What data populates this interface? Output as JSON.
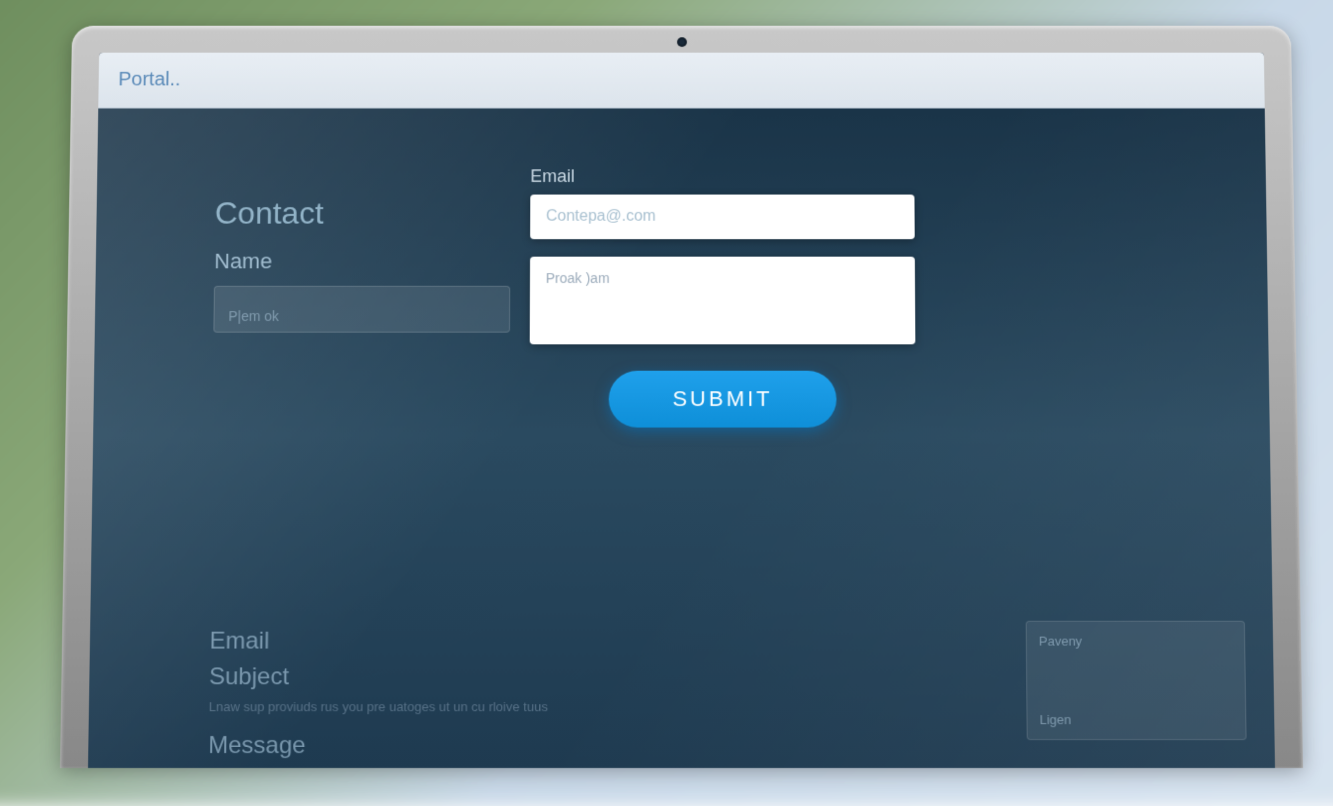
{
  "browser": {
    "address": "Portal.."
  },
  "page": {
    "title": "Contact"
  },
  "left_panel": {
    "name_label": "Name",
    "name_placeholder": "P|em  ok"
  },
  "center_form": {
    "email_label": "Email",
    "email_placeholder": "Contepa@.com",
    "message_placeholder": "Proak )am",
    "submit_label": "SUBMIT"
  },
  "bottom_labels": {
    "email": "Email",
    "subject": "Subject",
    "subject_desc": "Lnaw sup proviuds rus you pre uatoges  ut un  cu rloive tuus",
    "message": "Message"
  },
  "side_box": {
    "top": "Paveny",
    "bottom": "Ligen"
  },
  "colors": {
    "accent": "#1fa0eb"
  }
}
